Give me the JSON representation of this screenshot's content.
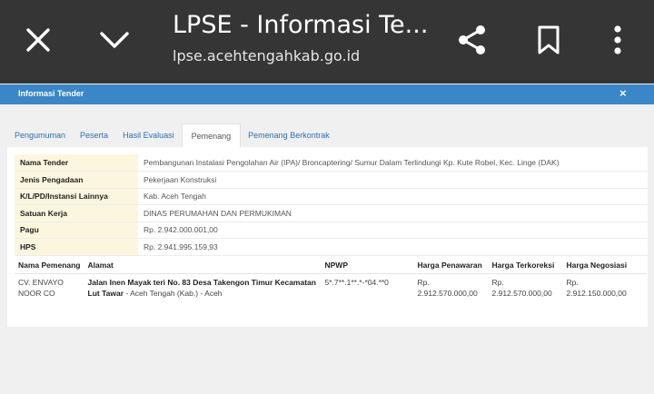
{
  "browser": {
    "title": "LPSE - Informasi Te...",
    "url": "lpse.acehtengahkab.go.id"
  },
  "panel": {
    "title": "Informasi Tender",
    "close": "×"
  },
  "tabs": [
    {
      "label": "Pengumuman",
      "active": false
    },
    {
      "label": "Peserta",
      "active": false
    },
    {
      "label": "Hasil Evaluasi",
      "active": false
    },
    {
      "label": "Pemenang",
      "active": true
    },
    {
      "label": "Pemenang Berkontrak",
      "active": false
    }
  ],
  "info": [
    {
      "label": "Nama Tender",
      "value": "Pembangunan Instalasi Pengolahan Air (IPA)/ Broncaptering/ Sumur Dalam Terlindungi Kp. Kute Robel, Kec. Linge (DAK)"
    },
    {
      "label": "Jenis Pengadaan",
      "value": "Pekerjaan Konstruksi"
    },
    {
      "label": "K/L/PD/Instansi Lainnya",
      "value": "Kab. Aceh Tengah"
    },
    {
      "label": "Satuan Kerja",
      "value": "DINAS PERUMAHAN DAN PERMUKIMAN"
    },
    {
      "label": "Pagu",
      "value": "Rp. 2.942.000.001,00"
    },
    {
      "label": "HPS",
      "value": "Rp. 2.941.995.159,93"
    }
  ],
  "winners": {
    "headers": [
      "Nama Pemenang",
      "Alamat",
      "NPWP",
      "Harga Penawaran",
      "Harga Terkoreksi",
      "Harga Negosiasi"
    ],
    "row": {
      "name_line1": "CV. ENVAYO",
      "name_line2": "NOOR CO",
      "address_bold_line1": "Jalan Inen Mayak teri No. 83 Desa Takengon Timur Kecamatan",
      "address_bold_line2": "Lut Tawar",
      "address_rest": " - Aceh Tengah (Kab.) - Aceh",
      "npwp": "5*.7**.1**.*-*04.**0",
      "penawaran_cur": "Rp.",
      "penawaran_val": "2.912.570.000,00",
      "terkoreksi_cur": "Rp.",
      "terkoreksi_val": "2.912.570.000,00",
      "negosiasi_cur": "Rp.",
      "negosiasi_val": "2.912.150.000,00"
    }
  }
}
